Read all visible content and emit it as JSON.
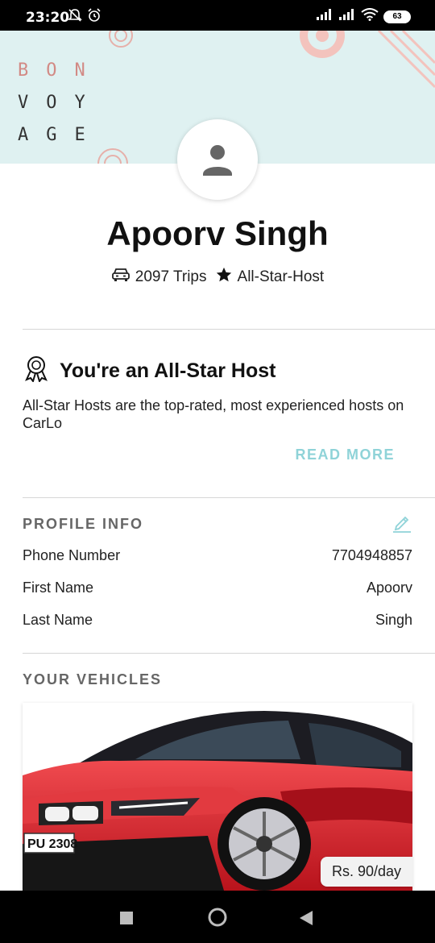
{
  "status_bar": {
    "time": "23:20",
    "battery": "63",
    "icons": [
      "mute-icon",
      "alarm-icon",
      "signal-icon",
      "signal-icon",
      "wifi-icon",
      "battery-icon"
    ]
  },
  "banner": {
    "text_lines": [
      "BON",
      "VOY",
      "AGE"
    ]
  },
  "profile": {
    "name": "Apoorv Singh",
    "trips": "2097 Trips",
    "badge": "All-Star-Host"
  },
  "allstar": {
    "title": "You're an All-Star Host",
    "description": "All-Star Hosts are the top-rated, most experienced hosts on CarLo",
    "read_more": "READ MORE"
  },
  "profile_info": {
    "heading": "PROFILE INFO",
    "rows": [
      {
        "label": "Phone Number",
        "value": "7704948857"
      },
      {
        "label": "First Name",
        "value": "Apoorv"
      },
      {
        "label": "Last Name",
        "value": "Singh"
      }
    ]
  },
  "vehicles": {
    "heading": "YOUR VEHICLES",
    "items": [
      {
        "plate": "PU 2308",
        "price": "Rs. 90/day"
      }
    ]
  },
  "colors": {
    "accent": "#8fd3d8",
    "banner": "#dff1f1",
    "car_red": "#d8202a"
  }
}
